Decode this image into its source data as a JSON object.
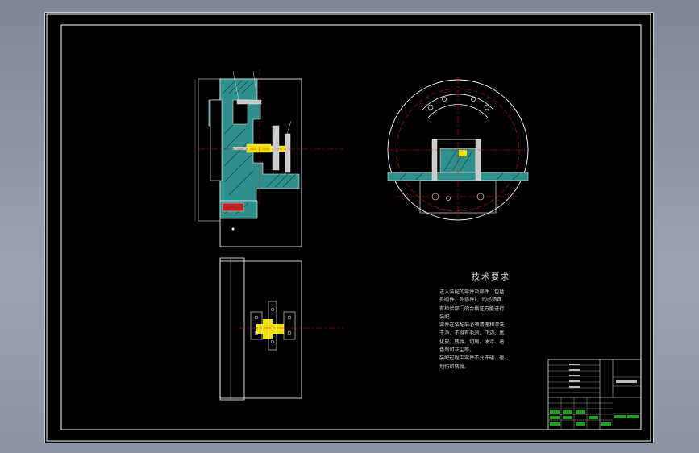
{
  "drawing": {
    "tech_title": "技术要求",
    "tech_lines": [
      "进入装配的零件及部件（包括",
      "外购件、外协件），均必须具",
      "有检验部门的合格证方能进行",
      "装配。",
      "零件在装配前必须清理和清洗",
      "干净，不得有毛刺、飞边、氧",
      "化皮、锈蚀、切屑、油污、着",
      "色剂和灰尘等。",
      "装配过程中零件不允许磕、碰、",
      "划伤和锈蚀。"
    ]
  },
  "colors": {
    "background": "#000000",
    "window_frame": "#8a94a3",
    "teal_section": "#2f8f8c",
    "centerline_red": "#e01010",
    "yellow_part": "#f2e100",
    "green_titleblock": "#1fa11f",
    "white_line": "#ffffff"
  }
}
